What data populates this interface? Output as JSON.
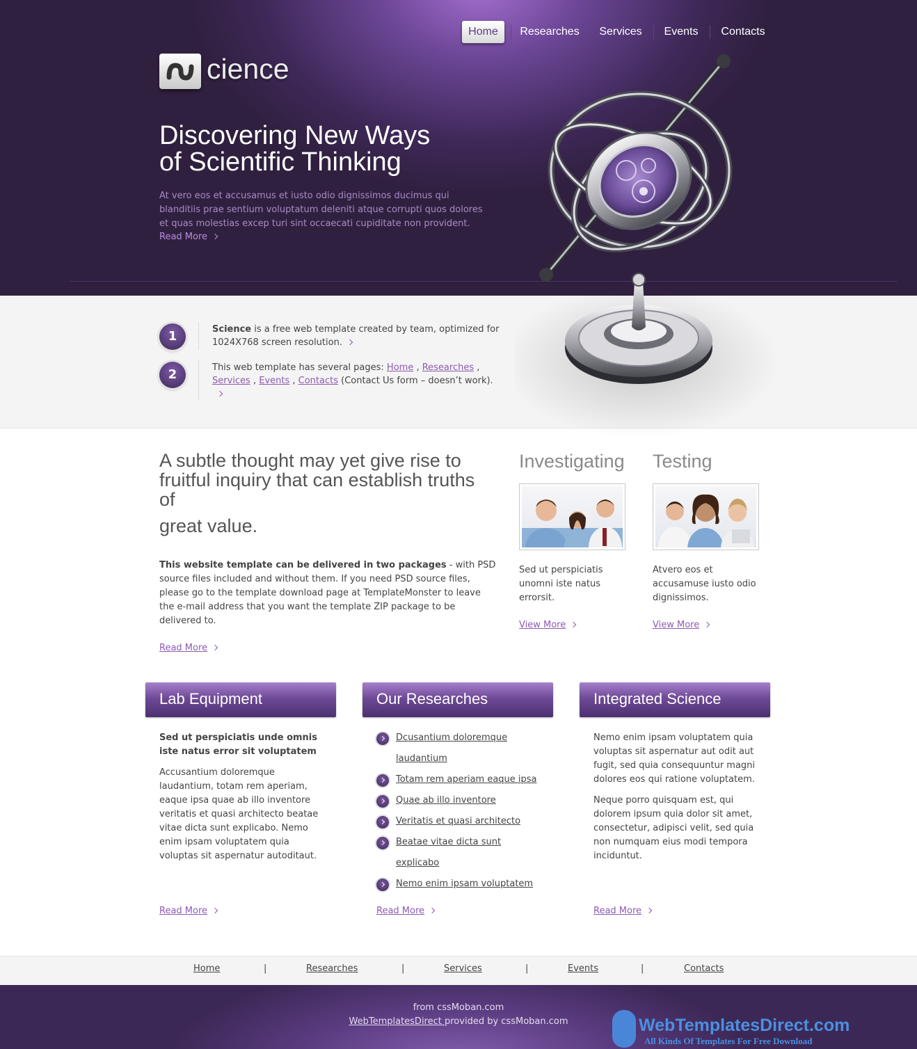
{
  "nav": {
    "items": [
      "Home",
      "Researches",
      "Services",
      "Events",
      "Contacts"
    ],
    "active": "Home"
  },
  "logo": {
    "text": "cience"
  },
  "hero": {
    "title_line1": "Discovering New Ways",
    "title_line2": "of Scientific Thinking",
    "text": "At vero eos et accusamus et iusto odio dignissimos ducimus qui blanditiis prae sentium voluptatum deleniti atque corrupti quos dolores et quas molestias excep turi sint occaecati cupiditate non provident.",
    "read_more": "Read More"
  },
  "intro": {
    "item1": {
      "number": "1",
      "bold": "Science",
      "text": " is a free web template created by team, optimized for 1024X768 screen resolution."
    },
    "item2": {
      "number": "2",
      "prefix": "This web template has several pages: ",
      "links": [
        "Home",
        "Researches",
        "Services",
        "Events",
        "Contacts"
      ],
      "suffix": "(Contact Us form – doesn’t work)."
    }
  },
  "main": {
    "quote_line": "A subtle thought may yet give rise to fruitful inquiry that can establish truths of",
    "quote_tail": "great value.",
    "bold": "This website template can be delivered in two packages",
    "text": " - with PSD source files included and without them. If you need PSD source files, please go to the template download page at TemplateMonster to leave the e-mail address that you want the template ZIP package to be delivered to.",
    "read_more": "Read More"
  },
  "investigating": {
    "title": "Investigating",
    "text": "Sed ut perspiciatis unomni iste natus errorsit.",
    "link": "View More"
  },
  "testing": {
    "title": "Testing",
    "text": "Atvero eos et accusamuse iusto odio dignissimos.",
    "link": "View More"
  },
  "lab": {
    "title": "Lab Equipment",
    "bold": "Sed ut perspiciatis unde omnis iste natus error sit voluptatem",
    "text": "Accusantium doloremque laudantium, totam rem aperiam, eaque ipsa quae ab illo inventore veritatis et quasi architecto beatae vitae dicta sunt explicabo. Nemo enim ipsam voluptatem quia voluptas sit aspernatur autoditaut.",
    "read_more": "Read More"
  },
  "researches": {
    "title": "Our Researches",
    "items": [
      "Dcusantium doloremque",
      "laudantium",
      "Totam rem aperiam eaque ipsa",
      "Quae ab illo inventore",
      "Veritatis et quasi architecto",
      "Beatae vitae dicta sunt",
      "explicabo",
      "Nemo enim ipsam voluptatem"
    ],
    "read_more": "Read More"
  },
  "integrated": {
    "title": "Integrated Science",
    "p1": "Nemo enim ipsam voluptatem quia voluptas sit aspernatur aut odit aut fugit, sed quia consequuntur magni dolores eos qui ratione voluptatem.",
    "p2": "Neque porro quisquam est, qui dolorem ipsum quia dolor sit amet, consectetur, adipisci velit, sed quia non numquam eius modi tempora inciduntut.",
    "read_more": "Read More"
  },
  "footer": {
    "links": [
      "Home",
      "Researches",
      "Services",
      "Events",
      "Contacts"
    ],
    "separator": "|",
    "from": "from cssMoban.com",
    "provider_link": "WebTemplatesDirect ",
    "provider_text": "provided by cssMoban.com",
    "watermark_title": "WebTemplatesDirect.com",
    "watermark_sub": "All Kinds Of Templates For Free Download"
  },
  "colors": {
    "brand_purple": "#5a3a80",
    "link_purple": "#8d5ab3",
    "watermark_blue": "#4a90e2"
  }
}
